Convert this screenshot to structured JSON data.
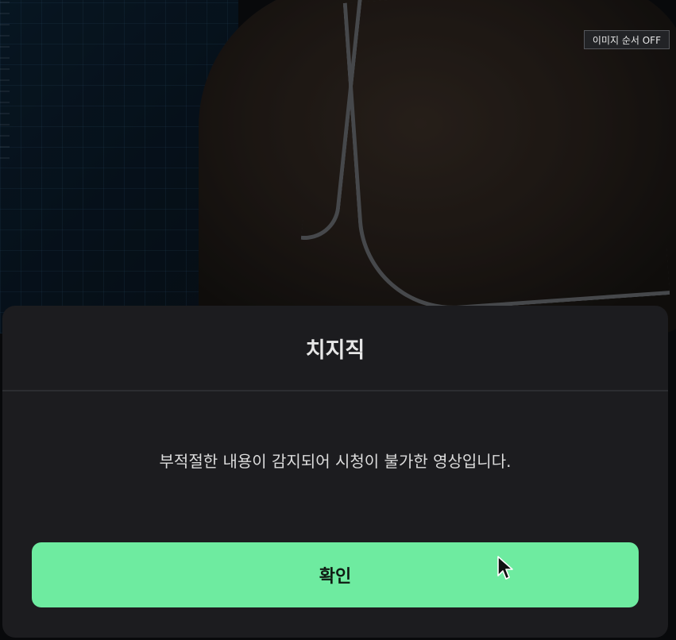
{
  "background_media": {
    "icon": "dimmed-video-frame"
  },
  "toolbar": {
    "image_order_toggle_label": "이미지 순서 OFF"
  },
  "modal": {
    "title": "치지직",
    "message": "부적절한 내용이 감지되어 시청이 불가한 영상입니다.",
    "confirm_label": "확인"
  },
  "colors": {
    "confirm_button": "#6eeba0",
    "modal_background": "#1c1c1f"
  },
  "cursor": {
    "icon": "mouse-pointer-icon"
  }
}
